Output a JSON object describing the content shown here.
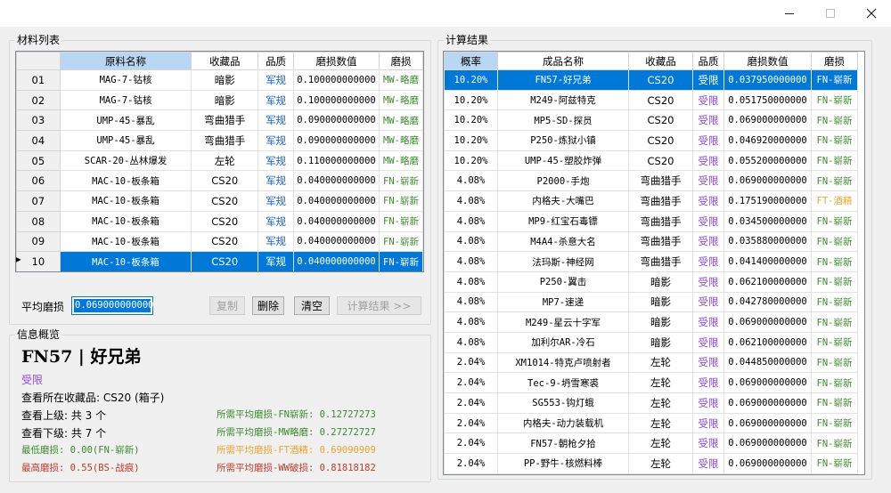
{
  "window": {
    "controls": {
      "minimize": "—",
      "maximize": "☐",
      "close": "✕"
    }
  },
  "materials": {
    "group_title": "材料列表",
    "columns": [
      "原料名称",
      "收藏品",
      "品质",
      "磨损数值",
      "磨损"
    ],
    "rows": [
      {
        "no": "01",
        "name": "MAG-7-钴核",
        "collection": "暗影",
        "quality": "军规",
        "float": "0.100000000000",
        "wear": "MW-略磨"
      },
      {
        "no": "02",
        "name": "MAG-7-钴核",
        "collection": "暗影",
        "quality": "军规",
        "float": "0.100000000000",
        "wear": "MW-略磨"
      },
      {
        "no": "03",
        "name": "UMP-45-暴乱",
        "collection": "弯曲猎手",
        "quality": "军规",
        "float": "0.090000000000",
        "wear": "MW-略磨"
      },
      {
        "no": "04",
        "name": "UMP-45-暴乱",
        "collection": "弯曲猎手",
        "quality": "军规",
        "float": "0.090000000000",
        "wear": "MW-略磨"
      },
      {
        "no": "05",
        "name": "SCAR-20-丛林爆发",
        "collection": "左轮",
        "quality": "军规",
        "float": "0.110000000000",
        "wear": "MW-略磨"
      },
      {
        "no": "06",
        "name": "MAC-10-板条箱",
        "collection": "CS20",
        "quality": "军规",
        "float": "0.040000000000",
        "wear": "FN-崭新"
      },
      {
        "no": "07",
        "name": "MAC-10-板条箱",
        "collection": "CS20",
        "quality": "军规",
        "float": "0.040000000000",
        "wear": "FN-崭新"
      },
      {
        "no": "08",
        "name": "MAC-10-板条箱",
        "collection": "CS20",
        "quality": "军规",
        "float": "0.040000000000",
        "wear": "FN-崭新"
      },
      {
        "no": "09",
        "name": "MAC-10-板条箱",
        "collection": "CS20",
        "quality": "军规",
        "float": "0.040000000000",
        "wear": "FN-崭新"
      },
      {
        "no": "10",
        "name": "MAC-10-板条箱",
        "collection": "CS20",
        "quality": "军规",
        "float": "0.040000000000",
        "wear": "FN-崭新",
        "selected": true
      }
    ],
    "avg_label": "平均磨损",
    "avg_value": "0.069000000000",
    "buttons": {
      "copy": "复制",
      "delete": "删除",
      "clear": "清空",
      "calc": "计算结果 >>"
    }
  },
  "results": {
    "group_title": "计算结果",
    "columns": [
      "概率",
      "成品名称",
      "收藏品",
      "品质",
      "磨损数值",
      "磨损"
    ],
    "rows": [
      {
        "prob": "10.20%",
        "name": "FN57-好兄弟",
        "collection": "CS20",
        "quality": "受限",
        "float": "0.037950000000",
        "wear": "FN-崭新",
        "selected": true
      },
      {
        "prob": "10.20%",
        "name": "M249-阿兹特克",
        "collection": "CS20",
        "quality": "受限",
        "float": "0.051750000000",
        "wear": "FN-崭新"
      },
      {
        "prob": "10.20%",
        "name": "MP5-SD-探员",
        "collection": "CS20",
        "quality": "受限",
        "float": "0.069000000000",
        "wear": "FN-崭新"
      },
      {
        "prob": "10.20%",
        "name": "P250-炼狱小镇",
        "collection": "CS20",
        "quality": "受限",
        "float": "0.046920000000",
        "wear": "FN-崭新"
      },
      {
        "prob": "10.20%",
        "name": "UMP-45-塑胶炸弹",
        "collection": "CS20",
        "quality": "受限",
        "float": "0.055200000000",
        "wear": "FN-崭新"
      },
      {
        "prob": "4.08%",
        "name": "P2000-手炮",
        "collection": "弯曲猎手",
        "quality": "受限",
        "float": "0.069000000000",
        "wear": "FN-崭新"
      },
      {
        "prob": "4.08%",
        "name": "内格夫-大嘴巴",
        "collection": "弯曲猎手",
        "quality": "受限",
        "float": "0.175190000000",
        "wear": "FT-酒精",
        "wear_class": "c-orange"
      },
      {
        "prob": "4.08%",
        "name": "MP9-红宝石毒镖",
        "collection": "弯曲猎手",
        "quality": "受限",
        "float": "0.034500000000",
        "wear": "FN-崭新"
      },
      {
        "prob": "4.08%",
        "name": "M4A4-杀意大名",
        "collection": "弯曲猎手",
        "quality": "受限",
        "float": "0.035880000000",
        "wear": "FN-崭新"
      },
      {
        "prob": "4.08%",
        "name": "法玛斯-神经网",
        "collection": "弯曲猎手",
        "quality": "受限",
        "float": "0.041400000000",
        "wear": "FN-崭新"
      },
      {
        "prob": "4.08%",
        "name": "P250-翼击",
        "collection": "暗影",
        "quality": "受限",
        "float": "0.062100000000",
        "wear": "FN-崭新"
      },
      {
        "prob": "4.08%",
        "name": "MP7-速递",
        "collection": "暗影",
        "quality": "受限",
        "float": "0.042780000000",
        "wear": "FN-崭新"
      },
      {
        "prob": "4.08%",
        "name": "M249-星云十字军",
        "collection": "暗影",
        "quality": "受限",
        "float": "0.069000000000",
        "wear": "FN-崭新"
      },
      {
        "prob": "4.08%",
        "name": "加利尔AR-冷石",
        "collection": "暗影",
        "quality": "受限",
        "float": "0.062100000000",
        "wear": "FN-崭新"
      },
      {
        "prob": "2.04%",
        "name": "XM1014-特克卢喷射者",
        "collection": "左轮",
        "quality": "受限",
        "float": "0.044850000000",
        "wear": "FN-崭新"
      },
      {
        "prob": "2.04%",
        "name": "Tec-9-坍雪寒裘",
        "collection": "左轮",
        "quality": "受限",
        "float": "0.069000000000",
        "wear": "FN-崭新"
      },
      {
        "prob": "2.04%",
        "name": "SG553-钩灯蛾",
        "collection": "左轮",
        "quality": "受限",
        "float": "0.069000000000",
        "wear": "FN-崭新"
      },
      {
        "prob": "2.04%",
        "name": "内格夫-动力装载机",
        "collection": "左轮",
        "quality": "受限",
        "float": "0.069000000000",
        "wear": "FN-崭新"
      },
      {
        "prob": "2.04%",
        "name": "FN57-朝枪夕拾",
        "collection": "左轮",
        "quality": "受限",
        "float": "0.069000000000",
        "wear": "FN-崭新"
      },
      {
        "prob": "2.04%",
        "name": "PP-野牛-核燃料棒",
        "collection": "左轮",
        "quality": "受限",
        "float": "0.069000000000",
        "wear": "FN-崭新"
      }
    ]
  },
  "info": {
    "group_title": "信息概览",
    "item_title": "FN57 | 好兄弟",
    "quality": "受限",
    "collection_line": "查看所在收藏品: CS20 (箱子)",
    "upper_line": "查看上级: 共 3 个",
    "lower_line": "查看下级: 共 7 个",
    "min_wear": "最低磨损: 0.00(FN-崭新)",
    "max_wear": "最高磨损: 0.55(BS-战痕)",
    "need_fn": "所需平均磨损-FN崭新: 0.12727273",
    "need_mw": "所需平均磨损-MW略磨: 0.27272727",
    "need_ft": "所需平均磨损-FT酒精: 0.69090909",
    "need_ww": "所需平均磨损-WW破损: 0.81818182"
  },
  "colors": {
    "selection": "#0078d7",
    "quality_mil": "#1a5fd0",
    "quality_restricted": "#8f4ad6",
    "wear_green": "#3c8a2e",
    "wear_orange": "#e8a431",
    "max_wear_red": "#c0392b"
  }
}
